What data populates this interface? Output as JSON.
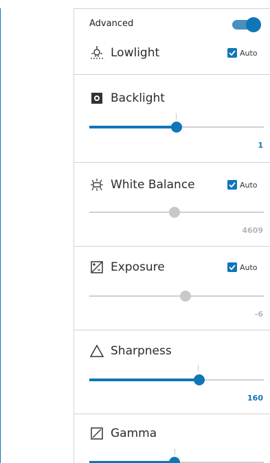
{
  "advanced": {
    "label": "Advanced",
    "enabled": true
  },
  "lowlight": {
    "label": "Lowlight",
    "icon": "lightbulb-icon",
    "auto_label": "Auto",
    "auto_checked": true
  },
  "backlight": {
    "label": "Backlight",
    "icon": "backlight-icon",
    "value": "1",
    "level": 0.5,
    "default_mark": 0.5
  },
  "white_balance": {
    "label": "White Balance",
    "icon": "white-balance-icon",
    "auto_label": "Auto",
    "auto_checked": true,
    "value": "4609",
    "level": 0.49
  },
  "exposure": {
    "label": "Exposure",
    "icon": "exposure-icon",
    "auto_label": "Auto",
    "auto_checked": true,
    "value": "-6",
    "level": 0.55
  },
  "sharpness": {
    "label": "Sharpness",
    "icon": "sharpness-icon",
    "value": "160",
    "level": 0.63,
    "default_mark": 0.63
  },
  "gamma": {
    "label": "Gamma",
    "icon": "gamma-icon",
    "level": 0.49,
    "default_mark": 0.49
  },
  "colors": {
    "accent": "#0f76b8",
    "disabled": "#c8c8c8"
  }
}
